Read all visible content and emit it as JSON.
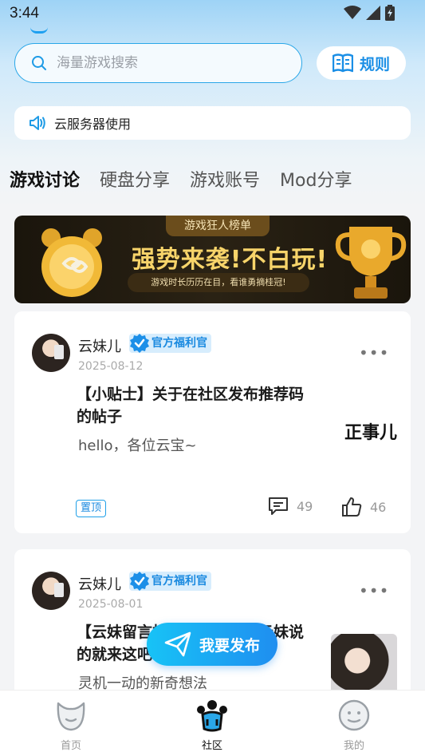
{
  "status_bar": {
    "time": "3:44"
  },
  "search": {
    "placeholder": "海量游戏搜索",
    "rules_label": "规则"
  },
  "notice": {
    "text": "云服务器使用"
  },
  "tabs": [
    {
      "label": "游戏讨论",
      "active": true
    },
    {
      "label": "硬盘分享"
    },
    {
      "label": "游戏账号"
    },
    {
      "label": "Mod分享"
    }
  ],
  "banner": {
    "tag": "游戏狂人榜单",
    "title": "强势来袭!不白玩!",
    "subtitle": "游戏时长历历在目，看谁勇摘桂冠!"
  },
  "posts": [
    {
      "author": "云妹儿",
      "badge": "官方福利官",
      "date": "2025-08-12",
      "title": "【小贴士】关于在社区发布推荐码的帖子",
      "body": "hello，各位云宝~",
      "thumb_text": "正事儿",
      "pin_label": "置顶",
      "comments": "49",
      "likes": "46"
    },
    {
      "author": "云妹儿",
      "badge": "官方福利官",
      "date": "2025-08-01",
      "title": "【云妹留言板】有什么想对云妹说的就来这吧",
      "body": "灵机一动的新奇想法"
    }
  ],
  "publish_button": {
    "label": "我要发布"
  },
  "bottom_nav": [
    {
      "label": "首页"
    },
    {
      "label": "社区",
      "active": true
    },
    {
      "label": "我的"
    }
  ],
  "colors": {
    "accent": "#1b8fe6",
    "badge_bg": "#d7edfd",
    "gold": "#f7d46a"
  }
}
